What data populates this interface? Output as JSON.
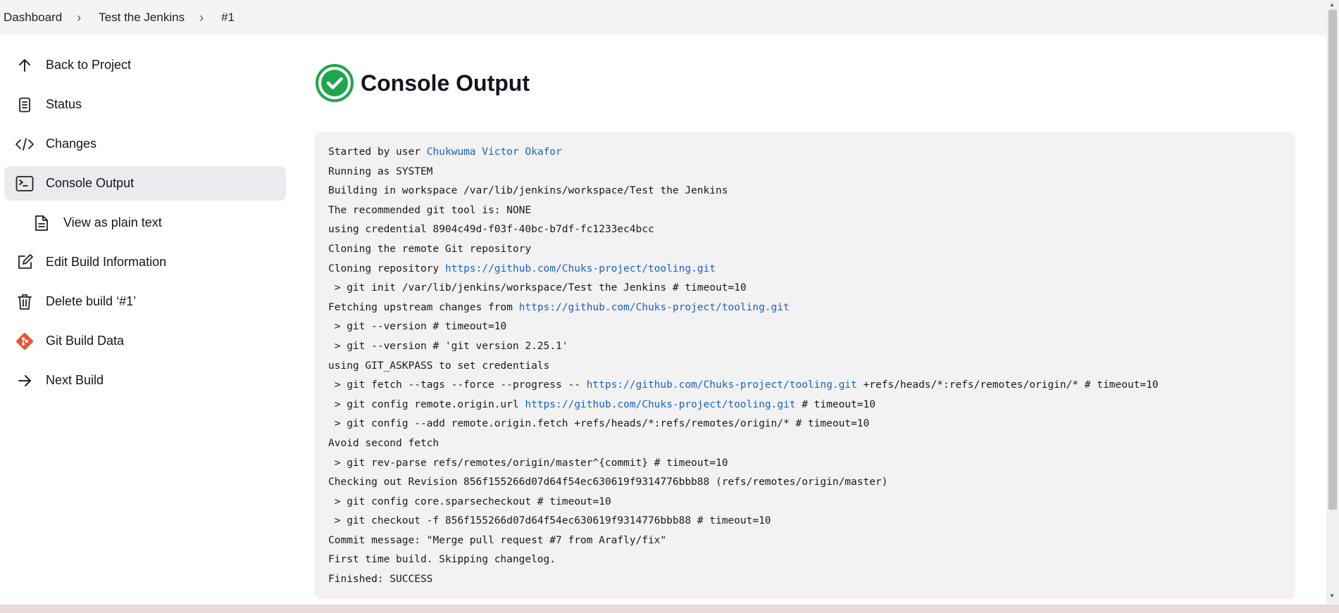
{
  "breadcrumb": [
    "Dashboard",
    "Test the Jenkins",
    "#1"
  ],
  "sidebar": {
    "items": [
      {
        "label": "Back to Project",
        "icon": "arrow-up-icon"
      },
      {
        "label": "Status",
        "icon": "document-icon"
      },
      {
        "label": "Changes",
        "icon": "code-icon"
      },
      {
        "label": "Console Output",
        "icon": "terminal-icon",
        "active": true
      },
      {
        "label": "View as plain text",
        "icon": "file-text-icon"
      },
      {
        "label": "Edit Build Information",
        "icon": "edit-icon"
      },
      {
        "label": "Delete build ‘#1’",
        "icon": "trash-icon"
      },
      {
        "label": "Git Build Data",
        "icon": "git-icon"
      },
      {
        "label": "Next Build",
        "icon": "arrow-right-icon"
      }
    ]
  },
  "main": {
    "title": "Console Output",
    "status_icon": "success-check-icon",
    "status_color": "#1ea64b"
  },
  "console": {
    "lines": [
      [
        {
          "t": "Started by user "
        },
        {
          "t": "Chukwuma Victor Okafor",
          "link": true
        }
      ],
      [
        {
          "t": "Running as SYSTEM"
        }
      ],
      [
        {
          "t": "Building in workspace /var/lib/jenkins/workspace/Test the Jenkins"
        }
      ],
      [
        {
          "t": "The recommended git tool is: NONE"
        }
      ],
      [
        {
          "t": "using credential 8904c49d-f03f-40bc-b7df-fc1233ec4bcc"
        }
      ],
      [
        {
          "t": "Cloning the remote Git repository"
        }
      ],
      [
        {
          "t": "Cloning repository "
        },
        {
          "t": "https://github.com/Chuks-project/tooling.git",
          "link": true
        }
      ],
      [
        {
          "t": " > git init /var/lib/jenkins/workspace/Test the Jenkins # timeout=10"
        }
      ],
      [
        {
          "t": "Fetching upstream changes from "
        },
        {
          "t": "https://github.com/Chuks-project/tooling.git",
          "link": true
        }
      ],
      [
        {
          "t": " > git --version # timeout=10"
        }
      ],
      [
        {
          "t": " > git --version # 'git version 2.25.1'"
        }
      ],
      [
        {
          "t": "using GIT_ASKPASS to set credentials"
        }
      ],
      [
        {
          "t": " > git fetch --tags --force --progress -- "
        },
        {
          "t": "https://github.com/Chuks-project/tooling.git",
          "link": true
        },
        {
          "t": " +refs/heads/*:refs/remotes/origin/* # timeout=10"
        }
      ],
      [
        {
          "t": " > git config remote.origin.url "
        },
        {
          "t": "https://github.com/Chuks-project/tooling.git",
          "link": true
        },
        {
          "t": " # timeout=10"
        }
      ],
      [
        {
          "t": " > git config --add remote.origin.fetch +refs/heads/*:refs/remotes/origin/* # timeout=10"
        }
      ],
      [
        {
          "t": "Avoid second fetch"
        }
      ],
      [
        {
          "t": " > git rev-parse refs/remotes/origin/master^{commit} # timeout=10"
        }
      ],
      [
        {
          "t": "Checking out Revision 856f155266d07d64f54ec630619f9314776bbb88 (refs/remotes/origin/master)"
        }
      ],
      [
        {
          "t": " > git config core.sparsecheckout # timeout=10"
        }
      ],
      [
        {
          "t": " > git checkout -f 856f155266d07d64f54ec630619f9314776bbb88 # timeout=10"
        }
      ],
      [
        {
          "t": "Commit message: \"Merge pull request #7 from Arafly/fix\""
        }
      ],
      [
        {
          "t": "First time build. Skipping changelog."
        }
      ],
      [
        {
          "t": "Finished: SUCCESS"
        }
      ]
    ]
  }
}
